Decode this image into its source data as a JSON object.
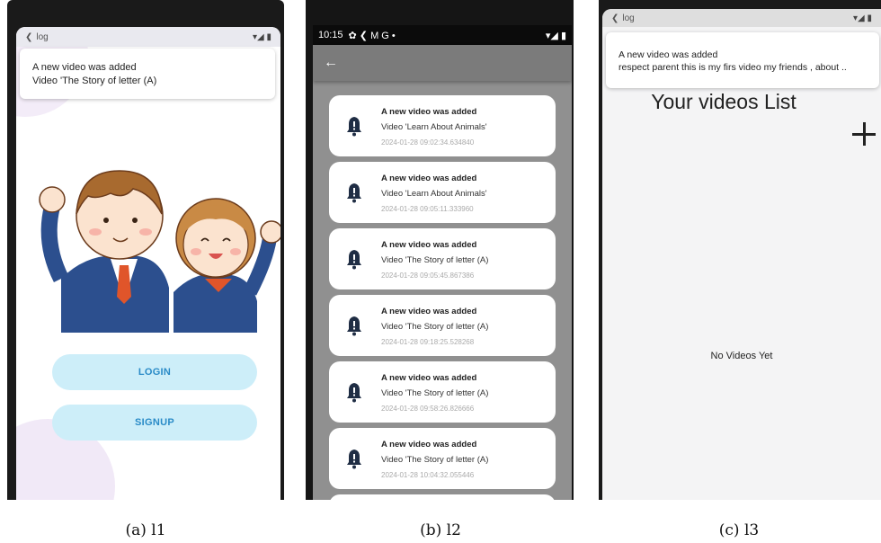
{
  "screen1": {
    "status_left": "log",
    "notification_title": "A new video was added",
    "notification_body": "Video 'The Story of letter (A)",
    "login_label": "LOGIN",
    "signup_label": "SIGNUP",
    "caption": "(a) l1"
  },
  "screen2": {
    "status_time": "10:15",
    "status_icons": "✿ ❮ M G •",
    "back_icon": "←",
    "notifications": [
      {
        "title": "A new video was added",
        "body": "Video 'Learn About Animals'",
        "time": "2024-01-28 09:02:34.634840"
      },
      {
        "title": "A new video was added",
        "body": "Video 'Learn About Animals'",
        "time": "2024-01-28 09:05:11.333960"
      },
      {
        "title": "A new video was added",
        "body": "Video 'The Story of letter (A)",
        "time": "2024-01-28 09:05:45.867386"
      },
      {
        "title": "A new video was added",
        "body": "Video 'The Story of letter (A)",
        "time": "2024-01-28 09:18:25.528268"
      },
      {
        "title": "A new video was added",
        "body": "Video 'The Story of letter (A)",
        "time": "2024-01-28 09:58:26.826666"
      },
      {
        "title": "A new video was added",
        "body": "Video 'The Story of letter (A)",
        "time": "2024-01-28 10:04:32.055446"
      }
    ],
    "caption": "(b) l2"
  },
  "screen3": {
    "status_left": "log",
    "notification_title": "A new video was added",
    "notification_body": "respect parent   this is my firs video my friends , about ..",
    "page_title": "Your videos List",
    "empty_text": "No Videos Yet",
    "caption": "(c) l3"
  },
  "colors": {
    "button_bg": "#cdeef9",
    "button_text": "#2a8bc7",
    "bell": "#1f2d44"
  }
}
